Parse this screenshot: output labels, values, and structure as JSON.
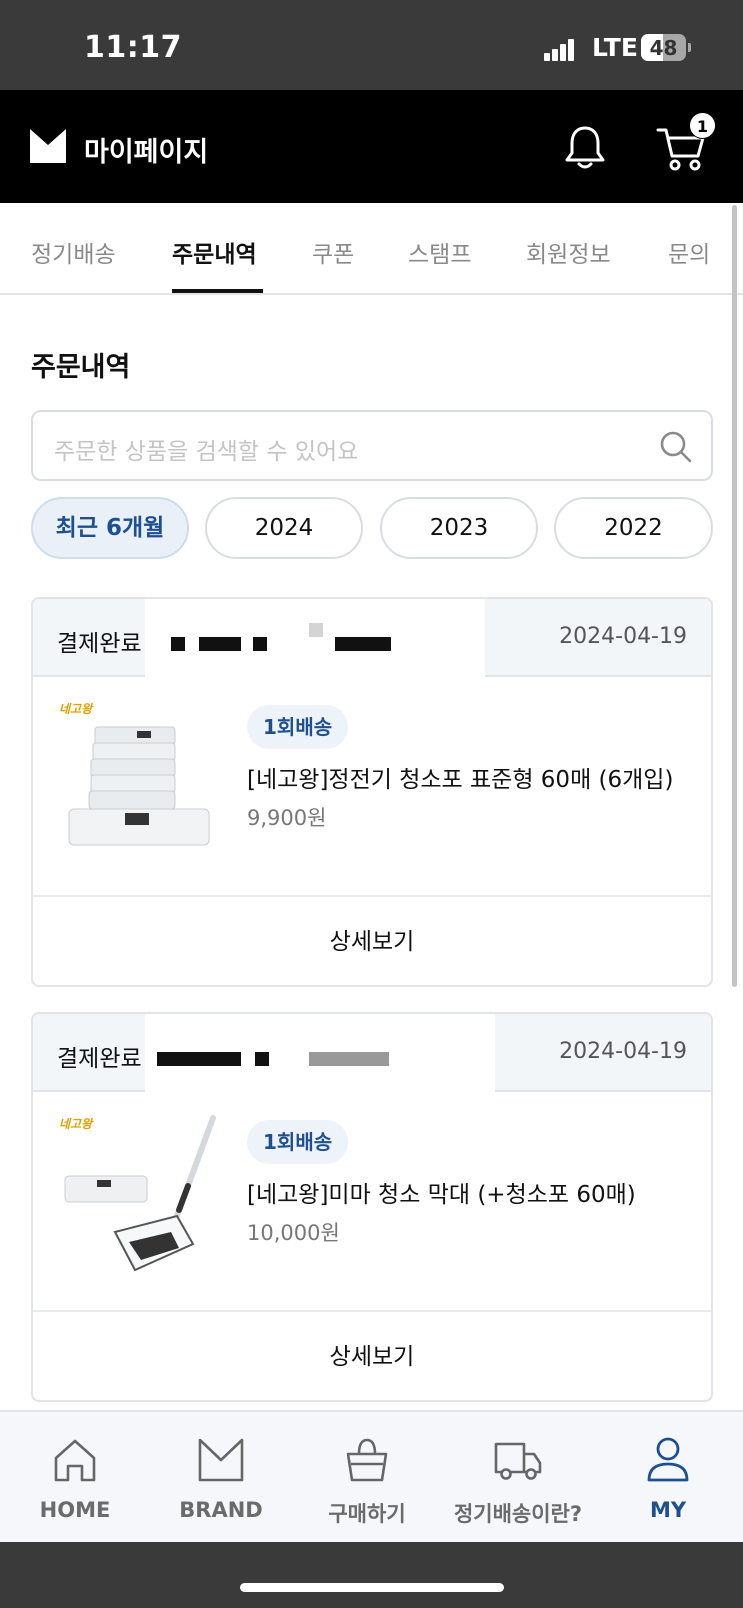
{
  "status_bar": {
    "time": "11:17",
    "network": "LTE",
    "battery": "48",
    "battery_level": 0.48
  },
  "header": {
    "title": "마이페이지",
    "cart_count": "1",
    "icons": [
      "logo-icon",
      "bell-icon",
      "cart-icon"
    ]
  },
  "tabs": [
    {
      "label": "정기배송",
      "active": false
    },
    {
      "label": "주문내역",
      "active": true
    },
    {
      "label": "쿠폰",
      "active": false
    },
    {
      "label": "스탬프",
      "active": false
    },
    {
      "label": "회원정보",
      "active": false
    },
    {
      "label": "문의",
      "active": false
    }
  ],
  "section_title": "주문내역",
  "search": {
    "placeholder": "주문한 상품을 검색할 수 있어요",
    "value": "",
    "icon": "search-icon"
  },
  "filters": [
    {
      "label": "최근 6개월",
      "active": true
    },
    {
      "label": "2024",
      "active": false
    },
    {
      "label": "2023",
      "active": false
    },
    {
      "label": "2022",
      "active": false
    }
  ],
  "orders": [
    {
      "status": "결제완료",
      "date": "2024-04-19",
      "delivery_badge": "1회배송",
      "product_name": "[네고왕]정전기 청소포 표준형 60매 (6개입)",
      "price": "9,900원",
      "detail_label": "상세보기"
    },
    {
      "status": "결제완료",
      "date": "2024-04-19",
      "delivery_badge": "1회배송",
      "product_name": "[네고왕]미마 청소 막대 (+청소포 60매)",
      "price": "10,000원",
      "detail_label": "상세보기"
    }
  ],
  "bottom_nav": [
    {
      "label": "HOME",
      "icon": "home-icon",
      "active": false
    },
    {
      "label": "BRAND",
      "icon": "brand-icon",
      "active": false
    },
    {
      "label": "구매하기",
      "icon": "shopping-bag-icon",
      "active": false
    },
    {
      "label": "정기배송이란?",
      "icon": "delivery-truck-icon",
      "active": false
    },
    {
      "label": "MY",
      "icon": "user-icon",
      "active": true
    }
  ],
  "colors": {
    "accent": "#1e4f8f",
    "header_bg": "#000000",
    "card_head_bg": "#f3f6f9",
    "chip_active_bg": "#e9f0f8"
  }
}
